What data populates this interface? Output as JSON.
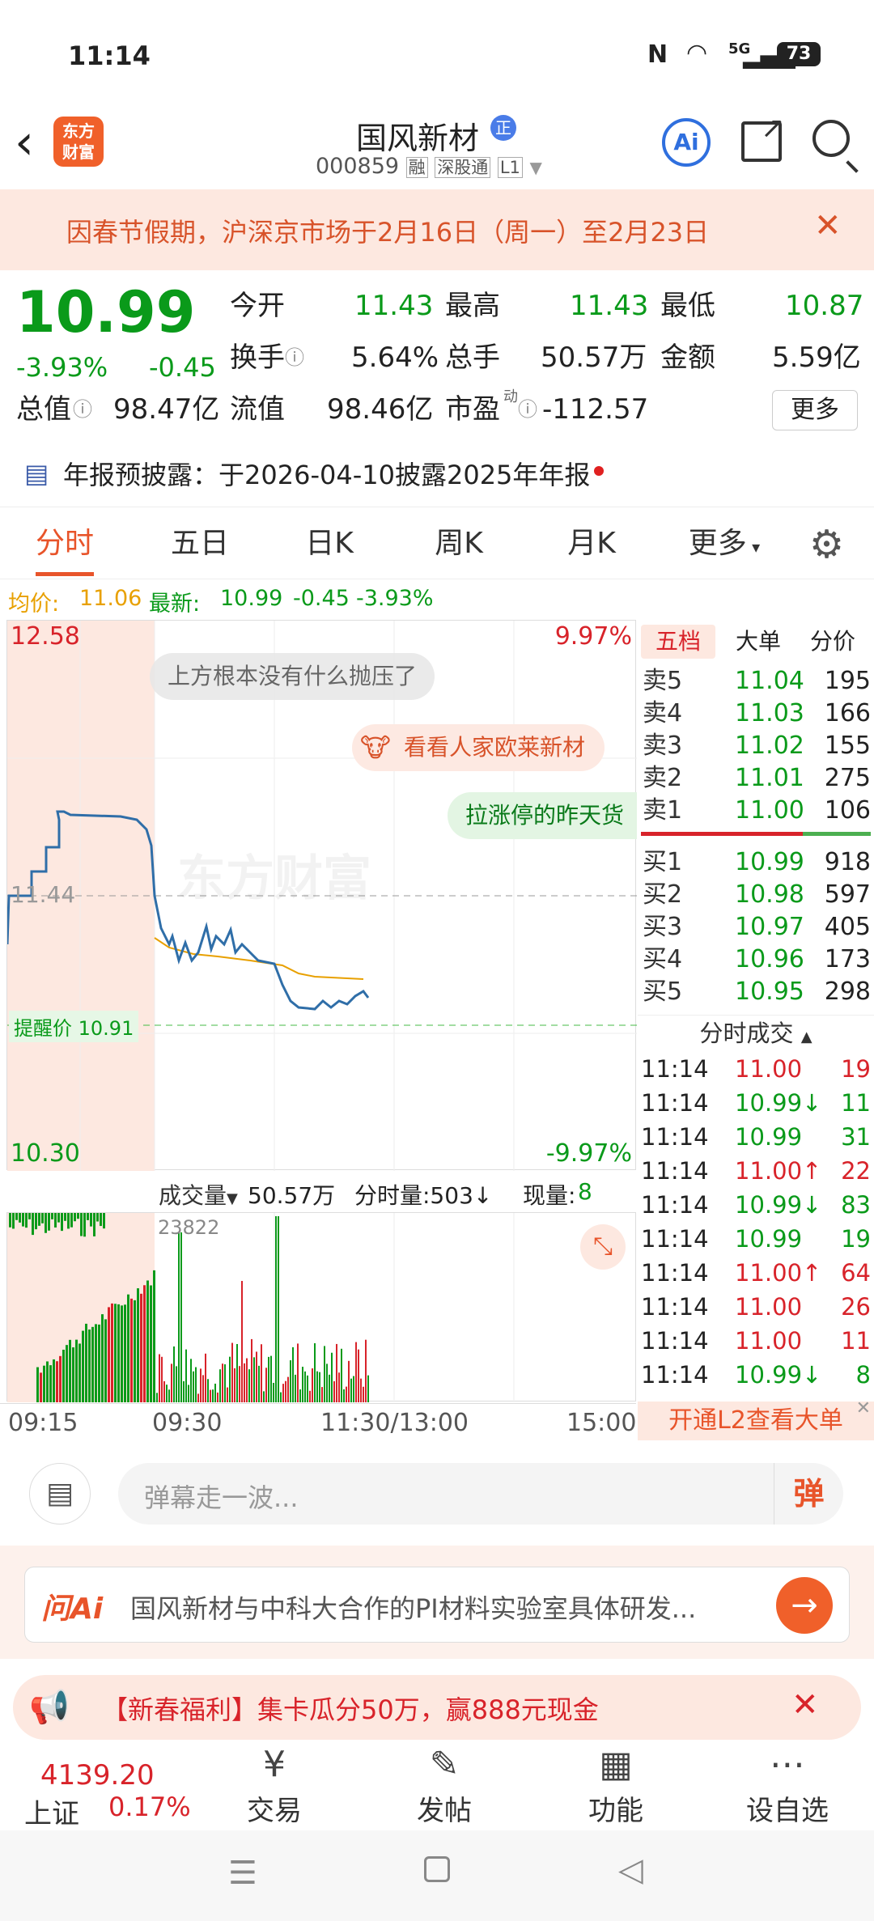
{
  "status": {
    "time": "11:14",
    "net": "5G",
    "battery": "73"
  },
  "header": {
    "title": "国风新材",
    "badge": "正",
    "code": "000859",
    "tags": [
      "融",
      "深股通",
      "L1"
    ]
  },
  "notice": {
    "text": "因春节假期，沪深京市场于2月16日（周一）至2月23日"
  },
  "quote": {
    "price": "10.99",
    "pct": "-3.93%",
    "chg": "-0.45",
    "open_label": "今开",
    "open": "11.43",
    "high_label": "最高",
    "high": "11.43",
    "low_label": "最低",
    "low": "10.87",
    "turnover_label": "换手",
    "turnover": "5.64%",
    "vol_label": "总手",
    "vol": "50.57万",
    "amount_label": "金额",
    "amount": "5.59亿",
    "mcap_label": "总值",
    "mcap": "98.47亿",
    "float_label": "流值",
    "float": "98.46亿",
    "pe_label": "市盈",
    "pe_sup": "动",
    "pe": "-112.57",
    "more": "更多"
  },
  "report": {
    "text": "年报预披露：于2026-04-10披露2025年年报"
  },
  "tabs": [
    "分时",
    "五日",
    "日K",
    "周K",
    "月K",
    "更多"
  ],
  "avg": {
    "avg_label": "均价:",
    "avg": "11.06",
    "last_label": "最新:",
    "last": "10.99",
    "chg": "-0.45",
    "pct": "-3.93%"
  },
  "chart": {
    "top_price": "12.58",
    "top_pct": "9.97%",
    "bottom_price": "10.30",
    "bottom_pct": "-9.97%",
    "mid_price": "11.44",
    "alert": "提醒价 10.91",
    "watermark": "东方财富",
    "danmu": [
      "上方根本没有什么抛压了",
      "看看人家欧莱新材",
      "拉涨停的昨天货"
    ]
  },
  "orderbook": {
    "tabs": [
      "五档",
      "大单",
      "分价"
    ],
    "asks": [
      {
        "label": "卖5",
        "price": "11.04",
        "vol": "195"
      },
      {
        "label": "卖4",
        "price": "11.03",
        "vol": "166"
      },
      {
        "label": "卖3",
        "price": "11.02",
        "vol": "155"
      },
      {
        "label": "卖2",
        "price": "11.01",
        "vol": "275"
      },
      {
        "label": "卖1",
        "price": "11.00",
        "vol": "106"
      }
    ],
    "bids": [
      {
        "label": "买1",
        "price": "10.99",
        "vol": "918"
      },
      {
        "label": "买2",
        "price": "10.98",
        "vol": "597"
      },
      {
        "label": "买3",
        "price": "10.97",
        "vol": "405"
      },
      {
        "label": "买4",
        "price": "10.96",
        "vol": "173"
      },
      {
        "label": "买5",
        "price": "10.95",
        "vol": "298"
      }
    ],
    "trades_title": "分时成交",
    "trades": [
      {
        "time": "11:14",
        "price": "11.00",
        "dir": "",
        "vol": "19",
        "color": "red"
      },
      {
        "time": "11:14",
        "price": "10.99",
        "dir": "↓",
        "vol": "11",
        "color": "green"
      },
      {
        "time": "11:14",
        "price": "10.99",
        "dir": "",
        "vol": "31",
        "color": "green"
      },
      {
        "time": "11:14",
        "price": "11.00",
        "dir": "↑",
        "vol": "22",
        "color": "red"
      },
      {
        "time": "11:14",
        "price": "10.99",
        "dir": "↓",
        "vol": "83",
        "color": "green"
      },
      {
        "time": "11:14",
        "price": "10.99",
        "dir": "",
        "vol": "19",
        "color": "green"
      },
      {
        "time": "11:14",
        "price": "11.00",
        "dir": "↑",
        "vol": "64",
        "color": "red"
      },
      {
        "time": "11:14",
        "price": "11.00",
        "dir": "",
        "vol": "26",
        "color": "red"
      },
      {
        "time": "11:14",
        "price": "11.00",
        "dir": "",
        "vol": "11",
        "color": "red"
      },
      {
        "time": "11:14",
        "price": "10.99",
        "dir": "↓",
        "vol": "8",
        "color": "green"
      }
    ],
    "l2": "开通L2查看大单"
  },
  "volume": {
    "label": "成交量",
    "total": "50.57万",
    "tick_label": "分时量:503↓",
    "now_label": "现量:",
    "now": "8",
    "max": "23822"
  },
  "timeaxis": [
    "09:15",
    "09:30",
    "11:30/13:00",
    "15:00"
  ],
  "danmu_input": {
    "placeholder": "弹幕走一波...",
    "send": "弹"
  },
  "ai": {
    "logo": "问Ai",
    "text": "国风新材与中科大合作的PI材料实验室具体研发..."
  },
  "promo": {
    "text": "【新春福利】集卡瓜分50万，赢888元现金"
  },
  "bottomnav": {
    "index_value": "4139.20",
    "index_name": "上证",
    "index_pct": "0.17%",
    "items": [
      "交易",
      "发帖",
      "功能",
      "设自选"
    ]
  },
  "colors": {
    "up": "#d8232a",
    "down": "#0a9a1a",
    "accent": "#f0602a"
  }
}
